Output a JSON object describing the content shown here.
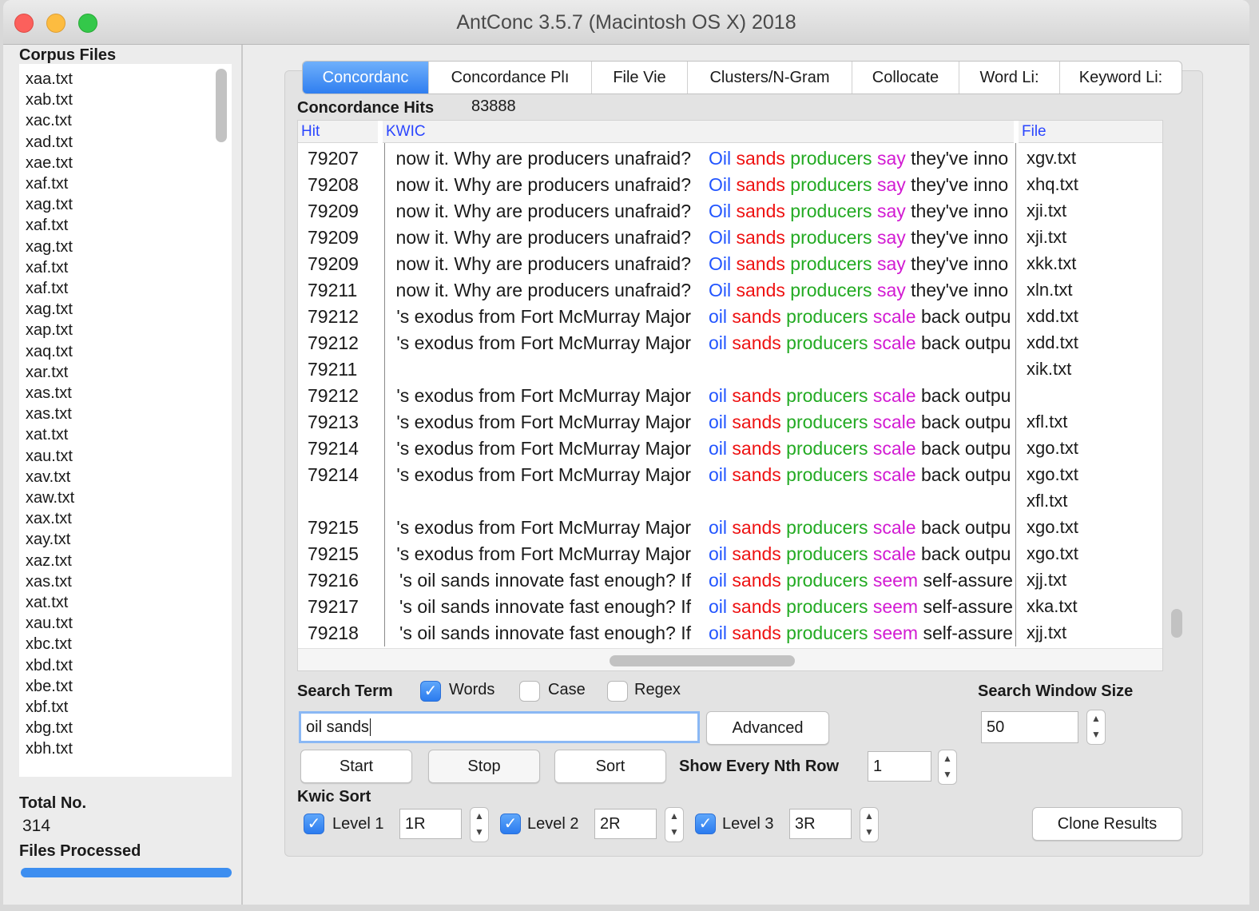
{
  "window": {
    "title": "AntConc 3.5.7 (Macintosh OS X) 2018"
  },
  "left": {
    "corpus_files_label": "Corpus Files",
    "files": [
      "xaa.txt",
      "xab.txt",
      "xac.txt",
      "xad.txt",
      "xae.txt",
      "xaf.txt",
      "xag.txt",
      "xaf.txt",
      "xag.txt",
      "xaf.txt",
      "xaf.txt",
      "xag.txt",
      "xap.txt",
      "xaq.txt",
      "xar.txt",
      "xas.txt",
      "xas.txt",
      "xat.txt",
      "xau.txt",
      "xav.txt",
      "xaw.txt",
      "xax.txt",
      "xay.txt",
      "xaz.txt",
      "xas.txt",
      "xat.txt",
      "xau.txt",
      "xbc.txt",
      "xbd.txt",
      "xbe.txt",
      "xbf.txt",
      "xbg.txt",
      "xbh.txt"
    ],
    "total_no_label": "Total No.",
    "total_no_value": "314",
    "files_processed_label": "Files Processed"
  },
  "tabs": [
    "Concordanc",
    "Concordance Plı",
    "File Vie",
    "Clusters/N-Gram",
    "Collocate",
    "Word Li:",
    "Keyword Li:"
  ],
  "concordance": {
    "hits_label": "Concordance Hits",
    "hits_value": "83888",
    "col_hit": "Hit",
    "col_kwic": "KWIC",
    "col_file": "File",
    "rows": [
      {
        "hit": "79207",
        "left": "now it. Why are producers unafraid?",
        "w1": "Oil",
        "w2": "sands",
        "w3": "producers",
        "w4": "say",
        "rest": "they've inno",
        "file": "xgv.txt"
      },
      {
        "hit": "79208",
        "left": "now it. Why are producers unafraid?",
        "w1": "Oil",
        "w2": "sands",
        "w3": "producers",
        "w4": "say",
        "rest": "they've inno",
        "file": "xhq.txt"
      },
      {
        "hit": "79209",
        "left": "now it. Why are producers unafraid?",
        "w1": "Oil",
        "w2": "sands",
        "w3": "producers",
        "w4": "say",
        "rest": "they've inno",
        "file": "xji.txt"
      },
      {
        "hit": "79209",
        "left": "now it. Why are producers unafraid?",
        "w1": "Oil",
        "w2": "sands",
        "w3": "producers",
        "w4": "say",
        "rest": "they've inno",
        "file": "xji.txt"
      },
      {
        "hit": "79209",
        "left": "now it. Why are producers unafraid?",
        "w1": "Oil",
        "w2": "sands",
        "w3": "producers",
        "w4": "say",
        "rest": "they've inno",
        "file": "xkk.txt"
      },
      {
        "hit": "79211",
        "left": "now it. Why are producers unafraid?",
        "w1": "Oil",
        "w2": "sands",
        "w3": "producers",
        "w4": "say",
        "rest": "they've inno",
        "file": "xln.txt"
      },
      {
        "hit": "79212",
        "left": "'s exodus from Fort McMurray Major",
        "w1": "oil",
        "w2": "sands",
        "w3": "producers",
        "w4": "scale",
        "rest": "back outpu",
        "file": "xdd.txt"
      },
      {
        "hit": "79212",
        "left": "'s exodus from Fort McMurray Major",
        "w1": "oil",
        "w2": "sands",
        "w3": "producers",
        "w4": "scale",
        "rest": "back outpu",
        "file": "xdd.txt"
      },
      {
        "hit": "79211",
        "left": "",
        "w1": "",
        "w2": "",
        "w3": "",
        "w4": "",
        "rest": "",
        "file": "xik.txt"
      },
      {
        "hit": "79212",
        "left": "'s exodus from Fort McMurray Major",
        "w1": "oil",
        "w2": "sands",
        "w3": "producers",
        "w4": "scale",
        "rest": "back outpu",
        "file": ""
      },
      {
        "hit": "79213",
        "left": "'s exodus from Fort McMurray Major",
        "w1": "oil",
        "w2": "sands",
        "w3": "producers",
        "w4": "scale",
        "rest": "back outpu",
        "file": "xfl.txt"
      },
      {
        "hit": "79214",
        "left": "'s exodus from Fort McMurray Major",
        "w1": "oil",
        "w2": "sands",
        "w3": "producers",
        "w4": "scale",
        "rest": "back outpu",
        "file": "xgo.txt"
      },
      {
        "hit": "79214",
        "left": "'s exodus from Fort McMurray Major",
        "w1": "oil",
        "w2": "sands",
        "w3": "producers",
        "w4": "scale",
        "rest": "back outpu",
        "file": "xgo.txt"
      },
      {
        "hit": "",
        "left": "",
        "w1": "",
        "w2": "",
        "w3": "",
        "w4": "",
        "rest": "",
        "file": "xfl.txt"
      },
      {
        "hit": "79215",
        "left": "'s exodus from Fort McMurray Major",
        "w1": "oil",
        "w2": "sands",
        "w3": "producers",
        "w4": "scale",
        "rest": "back outpu",
        "file": "xgo.txt"
      },
      {
        "hit": "79215",
        "left": "'s exodus from Fort McMurray Major",
        "w1": "oil",
        "w2": "sands",
        "w3": "producers",
        "w4": "scale",
        "rest": "back outpu",
        "file": "xgo.txt"
      },
      {
        "hit": "79216",
        "left": "'s oil sands innovate fast enough? If",
        "w1": "oil",
        "w2": "sands",
        "w3": "producers",
        "w4": "seem",
        "rest": "self-assure",
        "file": "xjj.txt"
      },
      {
        "hit": "79217",
        "left": "'s oil sands innovate fast enough? If",
        "w1": "oil",
        "w2": "sands",
        "w3": "producers",
        "w4": "seem",
        "rest": "self-assure",
        "file": "xka.txt"
      },
      {
        "hit": "79218",
        "left": "'s oil sands innovate fast enough? If",
        "w1": "oil",
        "w2": "sands",
        "w3": "producers",
        "w4": "seem",
        "rest": "self-assure",
        "file": "xjj.txt"
      }
    ]
  },
  "search": {
    "term_label": "Search Term",
    "words_label": "Words",
    "words_checked": true,
    "case_label": "Case",
    "case_checked": false,
    "regex_label": "Regex",
    "regex_checked": false,
    "query": "oil sands",
    "advanced_label": "Advanced",
    "window_size_label": "Search Window Size",
    "window_size": "50",
    "start_label": "Start",
    "stop_label": "Stop",
    "sort_label": "Sort",
    "nth_row_label": "Show Every Nth Row",
    "nth_row": "1"
  },
  "kwic_sort": {
    "label": "Kwic Sort",
    "level1_label": "Level 1",
    "level1": "1R",
    "level2_label": "Level 2",
    "level2": "2R",
    "level3_label": "Level 3",
    "level3": "3R",
    "clone_label": "Clone Results"
  },
  "colors": {
    "word1": "#2255ff",
    "word2": "#ee1111",
    "word3": "#22aa22",
    "word4": "#d21bd2",
    "accent": "#2f7ef0"
  }
}
